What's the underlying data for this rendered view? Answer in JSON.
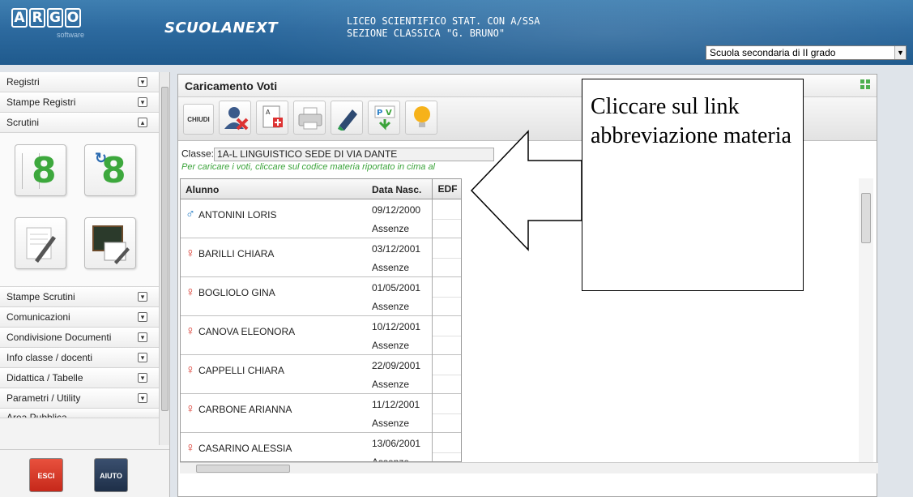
{
  "header": {
    "logo_letters": [
      "A",
      "R",
      "G",
      "O"
    ],
    "logo_sub": "software",
    "app_name": "SCUOLANEXT",
    "school_line1": "LICEO SCIENTIFICO STAT. CON A/SSA",
    "school_line2": "SEZIONE CLASSICA \"G. BRUNO\"",
    "grade_select": "Scuola secondaria di II grado"
  },
  "sidebar": {
    "items_top": [
      "Registri",
      "Stampe Registri",
      "Scrutini"
    ],
    "items_bottom": [
      "Stampe Scrutini",
      "Comunicazioni",
      "Condivisione Documenti",
      "Info classe / docenti",
      "Didattica / Tabelle",
      "Parametri / Utility",
      "Area Pubblica"
    ],
    "btn_esci": "ESCI",
    "btn_aiuto": "AIUTO"
  },
  "main": {
    "title": "Caricamento Voti",
    "chiudi": "CHIUDI",
    "classe_label": "Classe:",
    "classe_value": "1A-L LINGUISTICO SEDE DI VIA DANTE",
    "hint": "Per caricare i voti, cliccare sul codice materia riportato in cima al",
    "col_alunno": "Alunno",
    "col_data": "Data Nasc.",
    "col_edf": "EDF",
    "absence_label": "Assenze",
    "students": [
      {
        "name": "ANTONINI LORIS",
        "gender": "m",
        "dob": "09/12/2000"
      },
      {
        "name": "BARILLI CHIARA",
        "gender": "f",
        "dob": "03/12/2001"
      },
      {
        "name": "BOGLIOLO GINA",
        "gender": "f",
        "dob": "01/05/2001"
      },
      {
        "name": "CANOVA ELEONORA",
        "gender": "f",
        "dob": "10/12/2001"
      },
      {
        "name": "CAPPELLI CHIARA",
        "gender": "f",
        "dob": "22/09/2001"
      },
      {
        "name": "CARBONE ARIANNA",
        "gender": "f",
        "dob": "11/12/2001"
      },
      {
        "name": "CASARINO ALESSIA",
        "gender": "f",
        "dob": "13/06/2001"
      }
    ]
  },
  "callout": {
    "text": "Cliccare sul link abbreviazione materia"
  },
  "colors": {
    "accent_green": "#3aa339",
    "header_blue": "#2d6a9f",
    "male": "#2a7fc6",
    "female": "#d8352b"
  }
}
